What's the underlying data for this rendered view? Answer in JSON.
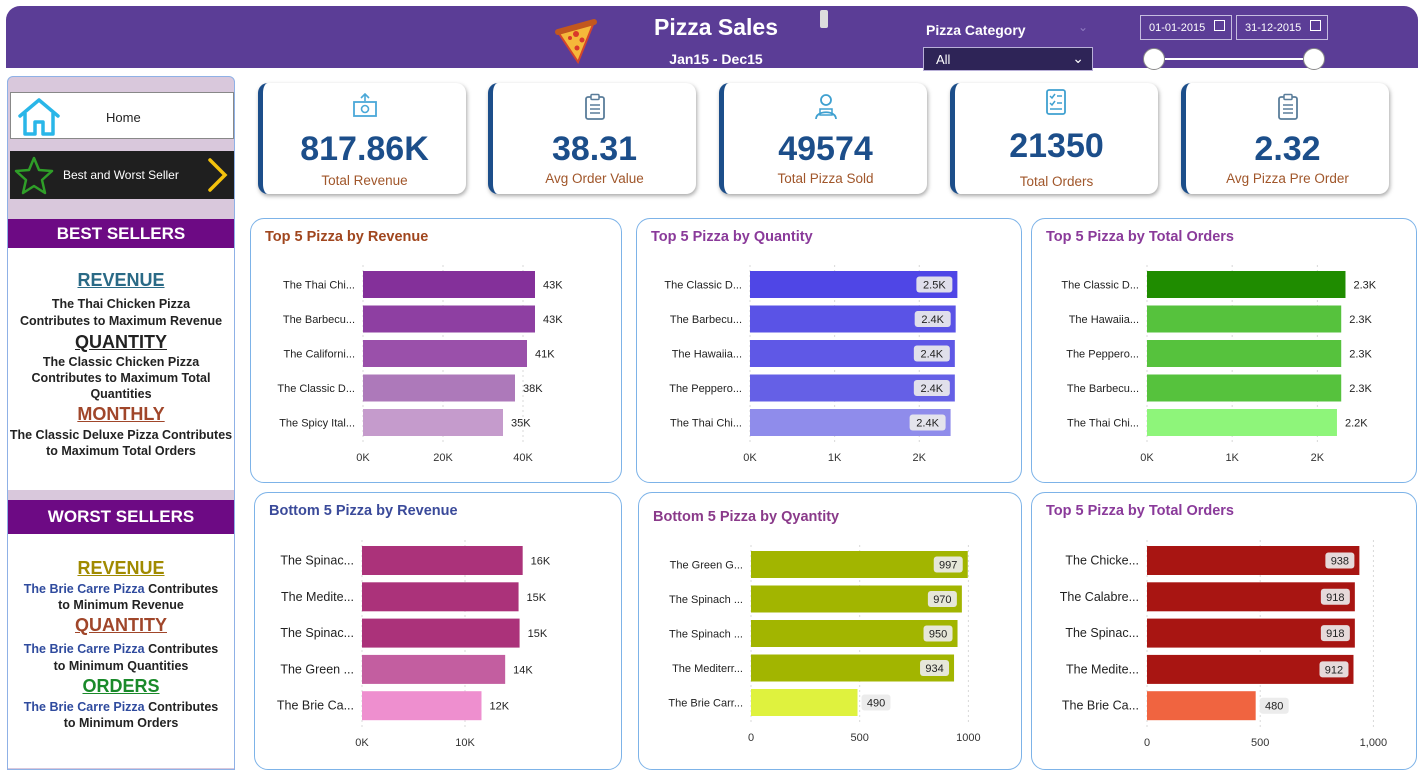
{
  "header": {
    "title": "Pizza Sales",
    "subtitle": "Jan15 - Dec15",
    "category_label": "Pizza Category",
    "category_value": "All",
    "date_start": "01-01-2015",
    "date_end": "31-12-2015"
  },
  "nav": {
    "home": "Home",
    "best_worst": "Best and Worst Seller"
  },
  "best": {
    "heading": "BEST SELLERS",
    "revenue_kw": "REVENUE",
    "revenue_txt1": "The Thai Chicken Pizza",
    "revenue_txt2": "Contributes to Maximum Revenue",
    "quantity_kw": "QUANTITY",
    "quantity_txt1": "The Classic Chicken Pizza",
    "quantity_txt2": "Contributes to Maximum Total",
    "quantity_txt3": "Quantities",
    "monthly_kw": "MONTHLY",
    "monthly_txt1": "The Classic Deluxe Pizza Contributes",
    "monthly_txt2": "to Maximum Total Orders"
  },
  "worst": {
    "heading": "WORST SELLERS",
    "revenue_kw": "REVENUE",
    "revenue_hl": "The Brie Carre Pizza",
    "revenue_txt1": " Contributes",
    "revenue_txt2": "to Minimum Revenue",
    "quantity_kw": "QUANTITY",
    "quantity_hl": "The Brie Carre Pizza",
    "quantity_txt1": " Contributes",
    "quantity_txt2": "to Minimum Quantities",
    "orders_kw": "ORDERS",
    "orders_hl": "The Brie Carre Pizza",
    "orders_txt1": " Contributes",
    "orders_txt2": "to Minimum Orders"
  },
  "kpis": [
    {
      "value": "817.86K",
      "label": "Total Revenue",
      "icon": "money-icon"
    },
    {
      "value": "38.31",
      "label": "Avg Order Value",
      "icon": "clipboard-icon"
    },
    {
      "value": "49574",
      "label": "Total Pizza Sold",
      "icon": "delivery-icon"
    },
    {
      "value": "21350",
      "label": "Total Orders",
      "icon": "checklist-icon"
    },
    {
      "value": "2.32",
      "label": "Avg Pizza Pre Order",
      "icon": "clipboard-icon"
    }
  ],
  "colors": {
    "header": "#5b3d96",
    "kpi_value": "#1c4e8a",
    "kpi_label": "#a0562a"
  },
  "chart_data": [
    {
      "id": "top-revenue",
      "type": "bar",
      "title": "Top 5 Pizza by Revenue",
      "title_color": "#a0461e",
      "categories": [
        "The Thai Chi...",
        "The Barbecu...",
        "The Californi...",
        "The Classic D...",
        "The Spicy Ital..."
      ],
      "values": [
        43,
        43,
        41,
        38,
        35
      ],
      "labels": [
        "43K",
        "43K",
        "41K",
        "38K",
        "35K"
      ],
      "colors": [
        "#84309a",
        "#8e3fa2",
        "#9a50aa",
        "#ad79ba",
        "#c59bcc"
      ],
      "ticks": [
        0,
        20,
        40
      ],
      "tick_labels": [
        "0K",
        "20K",
        "40K"
      ],
      "xlim": [
        0,
        50
      ],
      "label_style": "outside"
    },
    {
      "id": "top-quantity",
      "type": "bar",
      "title": "Top 5 Pizza by Quantity",
      "title_color": "#8a3a9a",
      "categories": [
        "The Classic D...",
        "The Barbecu...",
        "The Hawaiia...",
        "The Peppero...",
        "The Thai Chi..."
      ],
      "values": [
        2.45,
        2.43,
        2.42,
        2.42,
        2.37
      ],
      "labels": [
        "2.5K",
        "2.4K",
        "2.4K",
        "2.4K",
        "2.4K"
      ],
      "colors": [
        "#4f46e6",
        "#5a53e6",
        "#5f58e6",
        "#6560e6",
        "#8f8ceb"
      ],
      "ticks": [
        0,
        1,
        2
      ],
      "tick_labels": [
        "0K",
        "1K",
        "2K"
      ],
      "xlim": [
        0,
        2.8
      ],
      "label_style": "inside"
    },
    {
      "id": "top-orders",
      "type": "bar",
      "title": "Top 5 Pizza by Total Orders",
      "title_color": "#8a3a9a",
      "categories": [
        "The Classic D...",
        "The Hawaiia...",
        "The Peppero...",
        "The Barbecu...",
        "The Thai Chi..."
      ],
      "values": [
        2.33,
        2.28,
        2.28,
        2.28,
        2.23
      ],
      "labels": [
        "2.3K",
        "2.3K",
        "2.3K",
        "2.3K",
        "2.2K"
      ],
      "colors": [
        "#1f8c00",
        "#56c23d",
        "#56c23d",
        "#56c23d",
        "#8ef57a"
      ],
      "ticks": [
        0,
        1,
        2
      ],
      "tick_labels": [
        "0K",
        "1K",
        "2K"
      ],
      "xlim": [
        0,
        2.7
      ],
      "label_style": "outside"
    },
    {
      "id": "bottom-revenue",
      "type": "bar",
      "title": "Bottom 5 Pizza by Revenue",
      "title_color": "#3a4a9a",
      "categories": [
        "The Spinac...",
        "The Medite...",
        "The Spinac...",
        "The Green ...",
        "The Brie Ca..."
      ],
      "values": [
        15.6,
        15.2,
        15.3,
        13.9,
        11.6
      ],
      "labels": [
        "16K",
        "15K",
        "15K",
        "14K",
        "12K"
      ],
      "colors": [
        "#ab327a",
        "#ab327a",
        "#ab327a",
        "#c35ea0",
        "#ee8fcf"
      ],
      "ticks": [
        0,
        10
      ],
      "tick_labels": [
        "0K",
        "10K"
      ],
      "xlim": [
        0,
        20
      ],
      "label_style": "outside"
    },
    {
      "id": "bottom-quantity",
      "type": "bar",
      "title": "Bottom 5 Pizza by Qyantity",
      "title_color": "#8a3a8a",
      "categories": [
        "The Green G...",
        "The Spinach ...",
        "The Spinach ...",
        "The Mediterr...",
        "The Brie Carr..."
      ],
      "values": [
        997,
        970,
        950,
        934,
        490
      ],
      "labels": [
        "997",
        "970",
        "950",
        "934",
        "490"
      ],
      "colors": [
        "#a2b500",
        "#a2b500",
        "#a2b500",
        "#a2b500",
        "#dff23e"
      ],
      "ticks": [
        0,
        500,
        1000
      ],
      "tick_labels": [
        "0",
        "500",
        "1000"
      ],
      "xlim": [
        0,
        1150
      ],
      "label_style": "inside"
    },
    {
      "id": "bottom-orders",
      "type": "bar",
      "title": "Top 5 Pizza by Total Orders",
      "title_color": "#8a3a9a",
      "categories": [
        "The Chicke...",
        "The Calabre...",
        "The Spinac...",
        "The Medite...",
        "The Brie Ca..."
      ],
      "values": [
        938,
        918,
        918,
        912,
        480
      ],
      "labels": [
        "938",
        "918",
        "918",
        "912",
        "480"
      ],
      "colors": [
        "#a81512",
        "#a81512",
        "#a81512",
        "#a81512",
        "#f06440"
      ],
      "ticks": [
        0,
        500,
        1000
      ],
      "tick_labels": [
        "0",
        "500",
        "1,000"
      ],
      "xlim": [
        0,
        1060
      ],
      "label_style": "inside"
    }
  ]
}
